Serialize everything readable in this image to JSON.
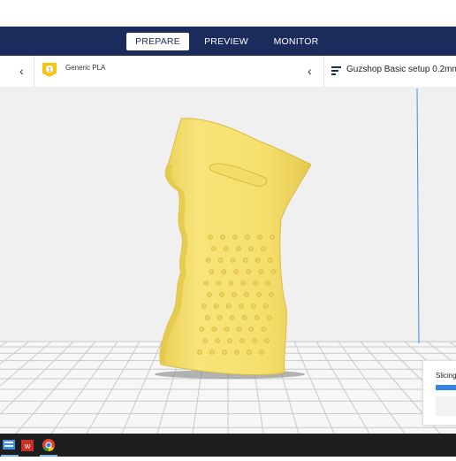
{
  "stages": {
    "prepare_label": "PREPARE",
    "preview_label": "PREVIEW",
    "monitor_label": "MONITOR",
    "active": "PREPARE"
  },
  "toolbar": {
    "material_icon": "spool-badge-icon",
    "material_badge": "1",
    "material_label": "Generic PLA",
    "profile_icon": "print-settings-icon",
    "profile_label": "Guzshop Basic setup 0.2mm"
  },
  "slicing": {
    "label": "Slicing",
    "progress_percent": 100
  },
  "model": {
    "color": "#f5e070",
    "description_icon": "pistol-grip-model"
  },
  "taskbar": {
    "apps": [
      "windows-explorer-icon",
      "autodesk-icon",
      "chrome-icon"
    ]
  },
  "colors": {
    "accent": "#1b2b5c",
    "progress": "#3282e8",
    "model": "#f5e070"
  }
}
